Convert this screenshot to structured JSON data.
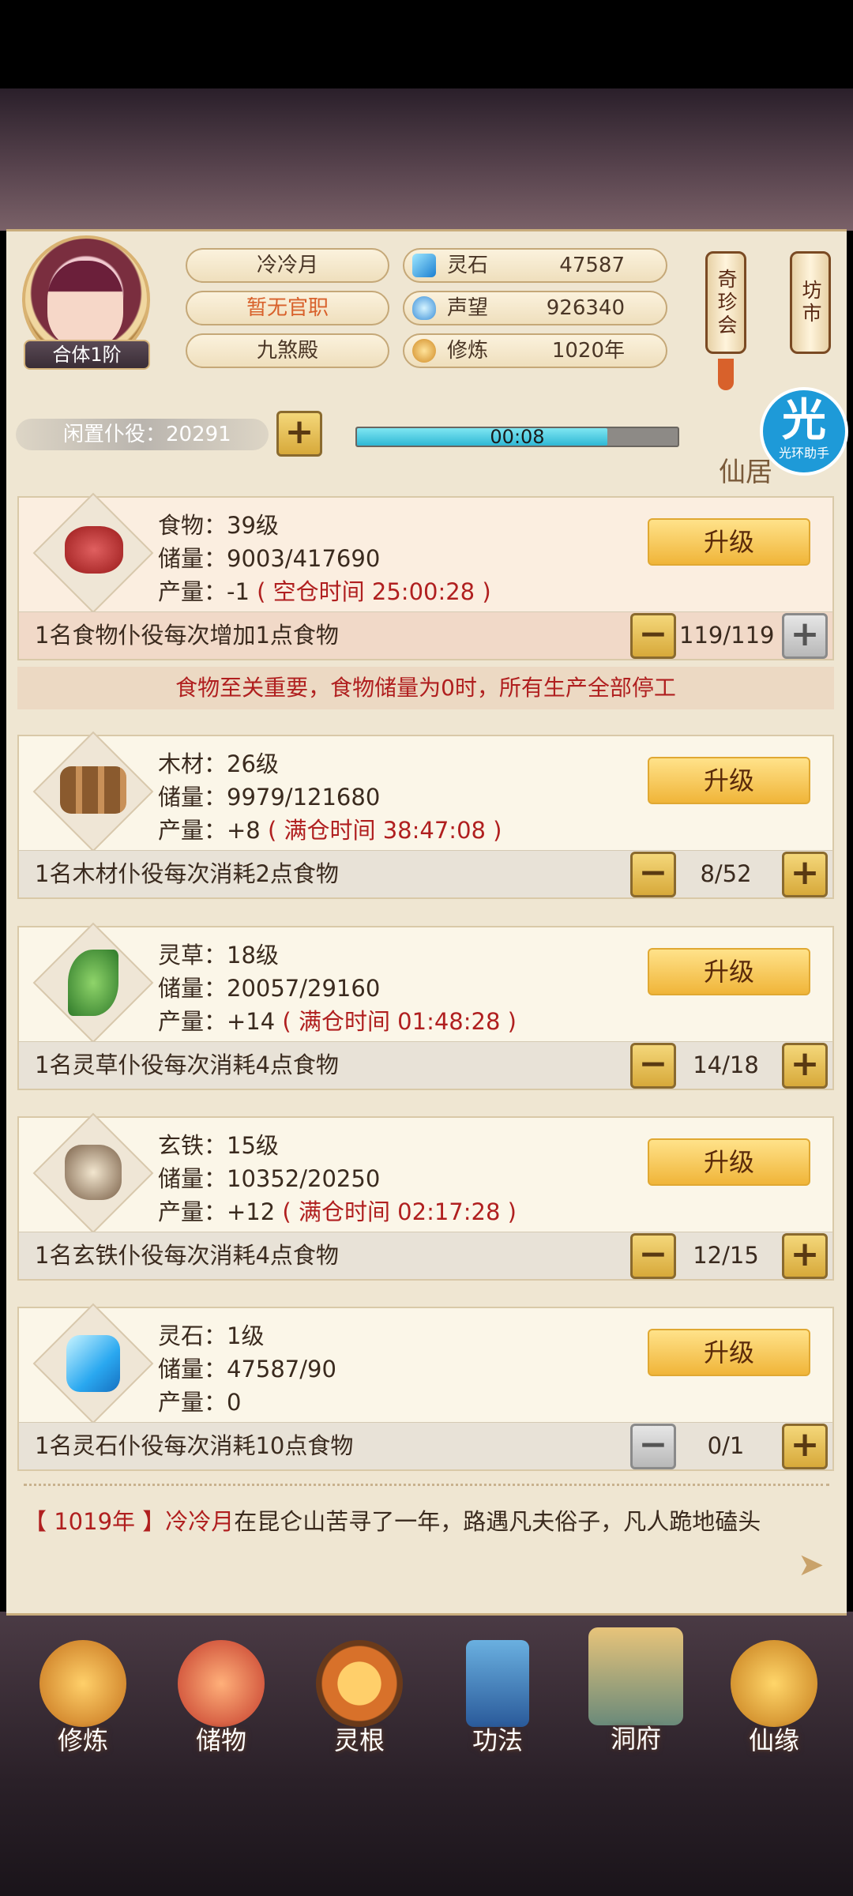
{
  "player": {
    "name": "冷冷月",
    "title": "暂无官职",
    "sect": "九煞殿",
    "rank": "合体1阶"
  },
  "stats": [
    {
      "label": "灵石",
      "value": "47587",
      "icon": "spirit-stone-icon"
    },
    {
      "label": "声望",
      "value": "926340",
      "icon": "reputation-icon"
    },
    {
      "label": "修炼",
      "value": "1020年",
      "icon": "cultivation-icon"
    }
  ],
  "side_buttons": {
    "treasure": "奇珍会",
    "market": "坊市"
  },
  "idle": {
    "label": "闲置仆役：20291",
    "timer": "00:08",
    "progress": 0.78
  },
  "badge": {
    "big": "光",
    "small": "光环助手",
    "location": "仙居"
  },
  "resources": [
    {
      "name": "食物：39级",
      "storage": "储量：9003/417690",
      "yield": "产量：-1",
      "time": "( 空仓时间 25:00:28 )",
      "upgrade": "升级",
      "foot": "1名食物仆役每次增加1点食物",
      "count": "119/119"
    },
    {
      "name": "木材：26级",
      "storage": "储量：9979/121680",
      "yield": "产量：+8",
      "time": "( 满仓时间 38:47:08 )",
      "upgrade": "升级",
      "foot": "1名木材仆役每次消耗2点食物",
      "count": "8/52"
    },
    {
      "name": "灵草：18级",
      "storage": "储量：20057/29160",
      "yield": "产量：+14",
      "time": "( 满仓时间 01:48:28 )",
      "upgrade": "升级",
      "foot": "1名灵草仆役每次消耗4点食物",
      "count": "14/18"
    },
    {
      "name": "玄铁：15级",
      "storage": "储量：10352/20250",
      "yield": "产量：+12",
      "time": "( 满仓时间 02:17:28 )",
      "upgrade": "升级",
      "foot": "1名玄铁仆役每次消耗4点食物",
      "count": "12/15"
    },
    {
      "name": "灵石：1级",
      "storage": "储量：47587/90",
      "yield": "产量：0",
      "time": "",
      "upgrade": "升级",
      "foot": "1名灵石仆役每次消耗10点食物",
      "count": "0/1"
    }
  ],
  "warning": "食物至关重要，食物储量为0时，所有生产全部停工",
  "log": {
    "year": "【 1019年 】",
    "name": "冷冷月",
    "text": "在昆仑山苦寻了一年，路遇凡夫俗子，凡人跪地磕头"
  },
  "nav": [
    {
      "label": "修炼",
      "icon": "meditate-icon"
    },
    {
      "label": "储物",
      "icon": "bag-icon"
    },
    {
      "label": "灵根",
      "icon": "spirit-root-icon"
    },
    {
      "label": "功法",
      "icon": "book-icon"
    },
    {
      "label": "洞府",
      "icon": "cave-mansion-icon"
    },
    {
      "label": "仙缘",
      "icon": "gourd-icon"
    }
  ],
  "colors": {
    "accent_red": "#b01f1f",
    "button_gold": "#f0b539",
    "progress_cyan": "#2fb8d5",
    "panel": "#efe6d2"
  }
}
